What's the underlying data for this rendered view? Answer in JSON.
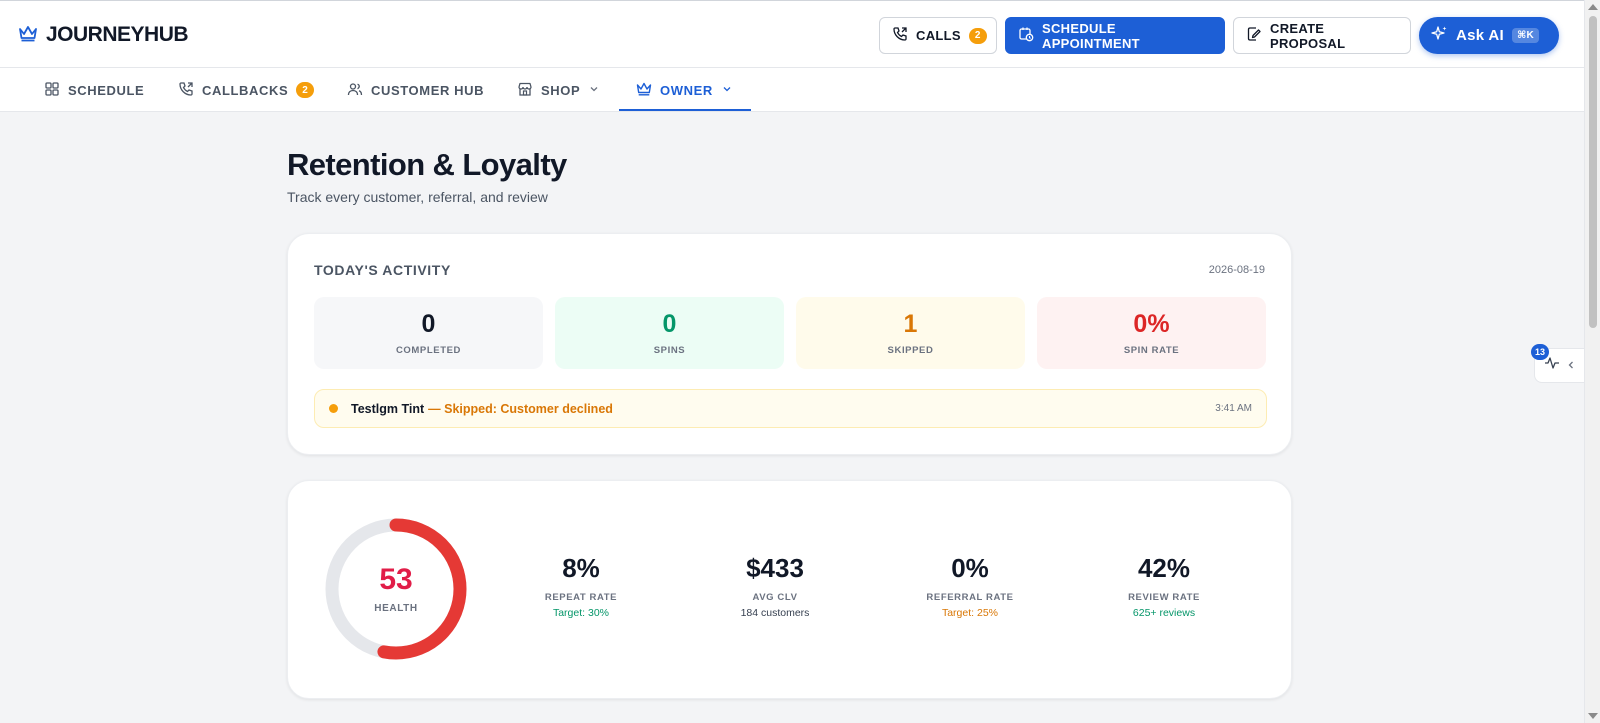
{
  "app": {
    "logo_text": "JOURNEYHUB"
  },
  "header": {
    "calls_label": "CALLS",
    "calls_badge": "2",
    "schedule_label": "SCHEDULE APPOINTMENT",
    "proposal_label": "CREATE PROPOSAL",
    "ai_label": "Ask AI",
    "ai_shortcut": "⌘K"
  },
  "nav": {
    "items": [
      {
        "label": "SCHEDULE"
      },
      {
        "label": "CALLBACKS",
        "badge": "2"
      },
      {
        "label": "CUSTOMER HUB"
      },
      {
        "label": "SHOP"
      },
      {
        "label": "OWNER"
      }
    ]
  },
  "page": {
    "title": "Retention & Loyalty",
    "subtitle": "Track every customer, referral, and review"
  },
  "activity": {
    "title": "TODAY'S ACTIVITY",
    "date": "2026-08-19",
    "stats": [
      {
        "value": "0",
        "label": "COMPLETED"
      },
      {
        "value": "0",
        "label": "SPINS"
      },
      {
        "value": "1",
        "label": "SKIPPED"
      },
      {
        "value": "0%",
        "label": "SPIN RATE"
      }
    ],
    "event": {
      "name": "Testlgm Tint",
      "status": "— Skipped: Customer declined",
      "time": "3:41 AM"
    }
  },
  "health": {
    "score": "53",
    "score_value": 53,
    "label": "HEALTH",
    "metrics": [
      {
        "value": "8%",
        "label": "REPEAT RATE",
        "sub": "Target: 30%"
      },
      {
        "value": "$433",
        "label": "AVG CLV",
        "sub": "184 customers"
      },
      {
        "value": "0%",
        "label": "REFERRAL RATE",
        "sub": "Target: 25%"
      },
      {
        "value": "42%",
        "label": "REVIEW RATE",
        "sub": "625+ reviews"
      }
    ]
  },
  "side_widget": {
    "badge": "13"
  },
  "colors": {
    "primary": "#1d5fd6",
    "badge": "#f59e0b",
    "health_score": "#e11d48",
    "success": "#059669",
    "warning": "#d97706",
    "danger": "#dc2626"
  }
}
